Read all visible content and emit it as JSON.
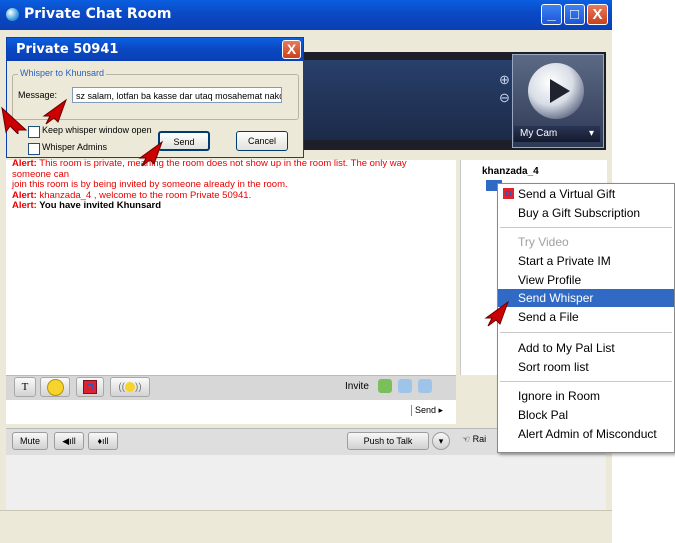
{
  "main_window": {
    "title": "Private Chat Room",
    "controls": {
      "minimize": "_",
      "maximize": "□",
      "close": "X"
    }
  },
  "video": {
    "cam_label": "My Cam"
  },
  "dialog": {
    "title": "Private 50941",
    "close": "X",
    "group_label": "Whisper to Khunsard",
    "message_label": "Message:",
    "message_value": "sz salam, lotfan ba kasse dar utaq mosahemat nako",
    "keep_open_label": "Keep whisper window open",
    "whisper_admins_label": "Whisper Admins",
    "send_label": "Send",
    "cancel_label": "Cancel"
  },
  "chat_log": [
    {
      "prefix": "Alert:",
      "text": " This room is private, meaning the room does not show up in the room list.  The only way someone can"
    },
    {
      "prefix": "",
      "text": "join this room is by being invited by someone already in the room."
    },
    {
      "prefix": "Alert:",
      "text": " khanzada_4 , welcome to the room  Private 50941."
    },
    {
      "prefix": "Alert:",
      "text": " You have invited Khunsard",
      "own": true
    }
  ],
  "user_list": {
    "user": "khanzada_4"
  },
  "toolbar": {
    "text_btn": "T",
    "invite_label": "Invite"
  },
  "input": {
    "send_label": "Send ▸"
  },
  "bottom": {
    "mute": "Mute",
    "push_to_talk": "Push to Talk",
    "raise_hand": "Rai"
  },
  "context_menu": {
    "items": [
      {
        "label": "Send a Virtual Gift",
        "disabled": false
      },
      {
        "label": "Buy a Gift Subscription",
        "disabled": false
      },
      {
        "label": "Try Video",
        "disabled": true
      },
      {
        "label": "Start a Private IM",
        "disabled": false
      },
      {
        "label": "View Profile",
        "disabled": false
      },
      {
        "label": "Send Whisper",
        "disabled": false,
        "highlighted": true
      },
      {
        "label": "Send a File",
        "disabled": false
      },
      {
        "label": "Add to My Pal List",
        "disabled": false
      },
      {
        "label": "Sort room list",
        "disabled": false
      },
      {
        "label": "Ignore in Room",
        "disabled": false
      },
      {
        "label": "Block Pal",
        "disabled": false
      },
      {
        "label": "Alert Admin of Misconduct",
        "disabled": false
      }
    ]
  },
  "colors": {
    "titlebar": "#0a4fd0",
    "highlight": "#316ac5",
    "alert_text": "#e00000",
    "annotation_arrow": "#cc0000"
  },
  "icons": [
    "app-icon",
    "zoom-in-icon",
    "zoom-out-icon",
    "play-icon",
    "gift-icon",
    "smiley-icon",
    "sound-icon",
    "add-user-icon",
    "annotation-arrow-icon"
  ]
}
